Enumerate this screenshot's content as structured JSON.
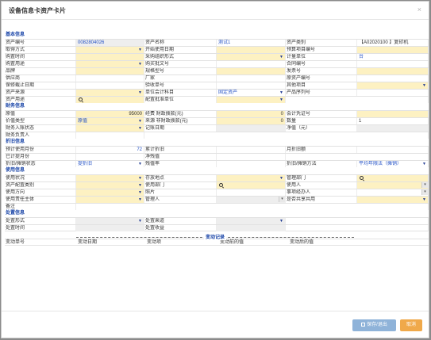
{
  "dialog": {
    "title": "设备信息卡资产卡片",
    "close": "×"
  },
  "sections": {
    "basic": "基本信息",
    "finance": "财务信息",
    "depreciation": "折旧信息",
    "usage": "使用信息",
    "disposal": "处置信息"
  },
  "basic": {
    "asset_no_label": "资产编号",
    "asset_no": "0082804026",
    "asset_name_label": "资产名称",
    "asset_name": "测试1",
    "asset_category_label": "资产类别",
    "asset_category": "【A02020100 】复印机",
    "acquire_method_label": "取得方式",
    "start_date_label": "开始使用日期",
    "budget_no_label": "预算项目编号",
    "purchase_time_label": "购置时间",
    "purchase_org_label": "采购组织形式",
    "unit_label": "计量单位",
    "unit": "台",
    "purchase_use_label": "购置用途",
    "approval_no_label": "购买批文号",
    "contract_no_label": "合同编号",
    "brand_label": "品牌",
    "spec_label": "规格型号",
    "invoice_no_label": "发票号",
    "supplier_label": "供应商",
    "manufacturer_label": "厂家",
    "original_no_label": "原资产编号",
    "warranty_label": "保修截止日期",
    "acceptance_no_label": "验收单号",
    "other_label": "其他项目",
    "source_label": "资产来源",
    "account_subject_label": "单位会计科目",
    "account_subject": "固定资产",
    "product_serial_label": "产品序列号",
    "purpose_label": "资产用途",
    "allocation_unit_label": "配置批准单位"
  },
  "finance": {
    "original_value_label": "原值",
    "original_value": "95000",
    "budget_fund_label": "经费 财政拨款(元)",
    "budget_fund": "0",
    "voucher_label": "会计凭证号",
    "value_type_label": "价值类型",
    "value_type": "原值",
    "non_fiscal_label": "来源 非财政拨款(元)",
    "non_fiscal": "0",
    "quantity_label": "数量",
    "quantity": "1",
    "entry_status_label": "财务入账状态",
    "entry_date_label": "记账日期",
    "net_value_label": "净值（元）",
    "finance_person_label": "财务负责人"
  },
  "depreciation": {
    "expected_months_label": "预计使用月份",
    "expected_months": "72",
    "accumulated_label": "累计折旧",
    "monthly_label": "月折旧额",
    "depreciated_months_label": "已计提月份",
    "net_value_label": "净残值",
    "status_label": "折旧/摊销状态",
    "status": "提折旧",
    "residual_rate_label": "残值率",
    "method_label": "折旧/摊销方法",
    "method": "平均年限法（摊销）"
  },
  "usage": {
    "usage_status_label": "使用状况",
    "location_label": "存放地点",
    "admin_dept_label": "管理部门",
    "config_type_label": "资产配置类别",
    "use_dept_label": "使用部门",
    "user_label": "使用人",
    "direction_label": "使用方向",
    "photo_label": "照片",
    "agent_label": "事项经办人",
    "responsible_label": "使用责任主体",
    "manager_label": "管理人",
    "shared_label": "是否共享共用",
    "remark_label": "备注"
  },
  "disposal": {
    "form_label": "处置形式",
    "channel_label": "处置渠道",
    "time_label": "处置时间",
    "income_label": "处置收益"
  },
  "change_log": {
    "title": "变动记录",
    "columns": [
      "变动单号",
      "变动日期",
      "变动项",
      "变动前的值",
      "变动后的值"
    ]
  },
  "footer": {
    "save": "保存/退出",
    "cancel": "取消"
  }
}
